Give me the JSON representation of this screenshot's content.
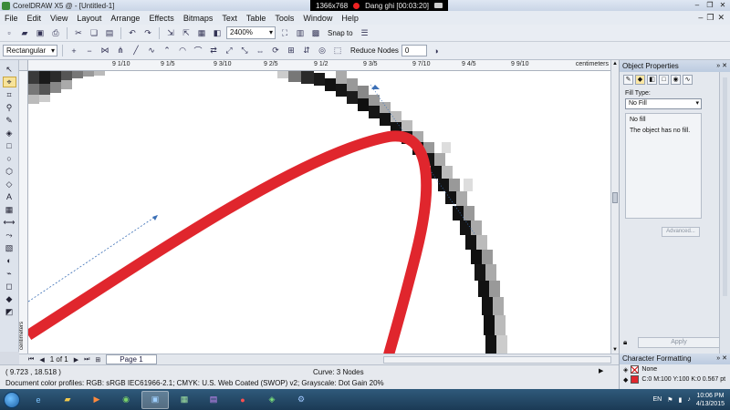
{
  "window": {
    "title": "CorelDRAW X5 @ - [Untitled-1]",
    "recorder_resolution": "1366x768",
    "recorder_status": "Dang ghi [00:03:20]"
  },
  "menu": [
    "File",
    "Edit",
    "View",
    "Layout",
    "Arrange",
    "Effects",
    "Bitmaps",
    "Text",
    "Table",
    "Tools",
    "Window",
    "Help"
  ],
  "toolbar": {
    "zoom": "2400%",
    "snap_to": "Snap to"
  },
  "propbar": {
    "shape_select": "Rectangular",
    "reduce_nodes_label": "Reduce Nodes",
    "reduce_nodes_value": "0"
  },
  "ruler": {
    "labels": [
      "9 1/10",
      "9 1/5",
      "9 3/10",
      "9 2/5",
      "9 1/2",
      "9 3/5",
      "9 7/10",
      "9 4/5",
      "9 9/10"
    ],
    "units": "centimeters",
    "v_units": "centimeters"
  },
  "pagebar": {
    "page_count": "1 of 1",
    "page_tab": "Page 1"
  },
  "status": {
    "coords": "( 9.723 , 18.518 )",
    "curve_info": "Curve: 3 Nodes",
    "color_profile": "Document color profiles: RGB: sRGB IEC61966-2.1; CMYK: U.S. Web Coated (SWOP) v2; Grayscale: Dot Gain 20%"
  },
  "object_properties": {
    "title": "Object Properties",
    "fill_type_label": "Fill Type:",
    "fill_type_value": "No Fill",
    "panel_title": "No fill",
    "panel_text": "The object has no fill.",
    "advanced_button": "Advanced...",
    "apply_button": "Apply"
  },
  "character_formatting": {
    "title": "Character Formatting",
    "outline_value": "None",
    "fill_value": "C:0 M:100 Y:100 K:0  0.567 pt",
    "fill_color": "#e0262d"
  },
  "taskbar": {
    "language": "EN",
    "time": "10:06 PM",
    "date": "4/13/2015"
  },
  "colors": {
    "curve_red": "#e0262d",
    "accent": "#3b6fb6"
  }
}
